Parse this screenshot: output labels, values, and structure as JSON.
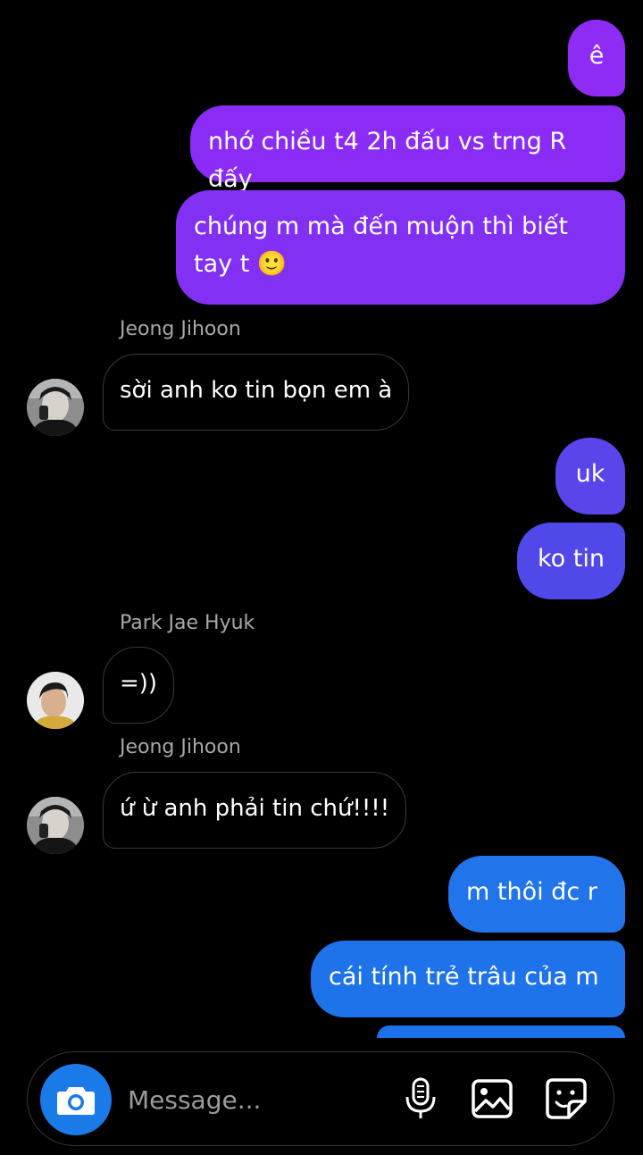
{
  "messages": [
    {
      "text": "ê"
    },
    {
      "text": "nhớ chiều t4 2h đấu vs trng R đấy"
    },
    {
      "text": "chúng m mà đến muộn thì biết tay t 🙂"
    },
    {
      "text": "sời anh ko tin bọn em à"
    },
    {
      "text": "uk"
    },
    {
      "text": "ko tin"
    },
    {
      "text": "=))"
    },
    {
      "text": "ứ ừ anh phải tin chứ!!!!"
    },
    {
      "text": "m thôi đc r"
    },
    {
      "text": "cái tính trẻ trâu của m"
    }
  ],
  "senders": {
    "jihoon": "Jeong Jihoon",
    "jaehyuk": "Park Jae Hyuk"
  },
  "composer": {
    "placeholder": "Message..."
  },
  "icons": {
    "camera": "camera-icon",
    "mic": "microphone-icon",
    "gallery": "image-icon",
    "sticker": "sticker-icon"
  },
  "colors": {
    "purple": "#8a2cf5",
    "indigo": "#5646e8",
    "blue": "#1f73ea",
    "accent": "#1a7ae8"
  }
}
